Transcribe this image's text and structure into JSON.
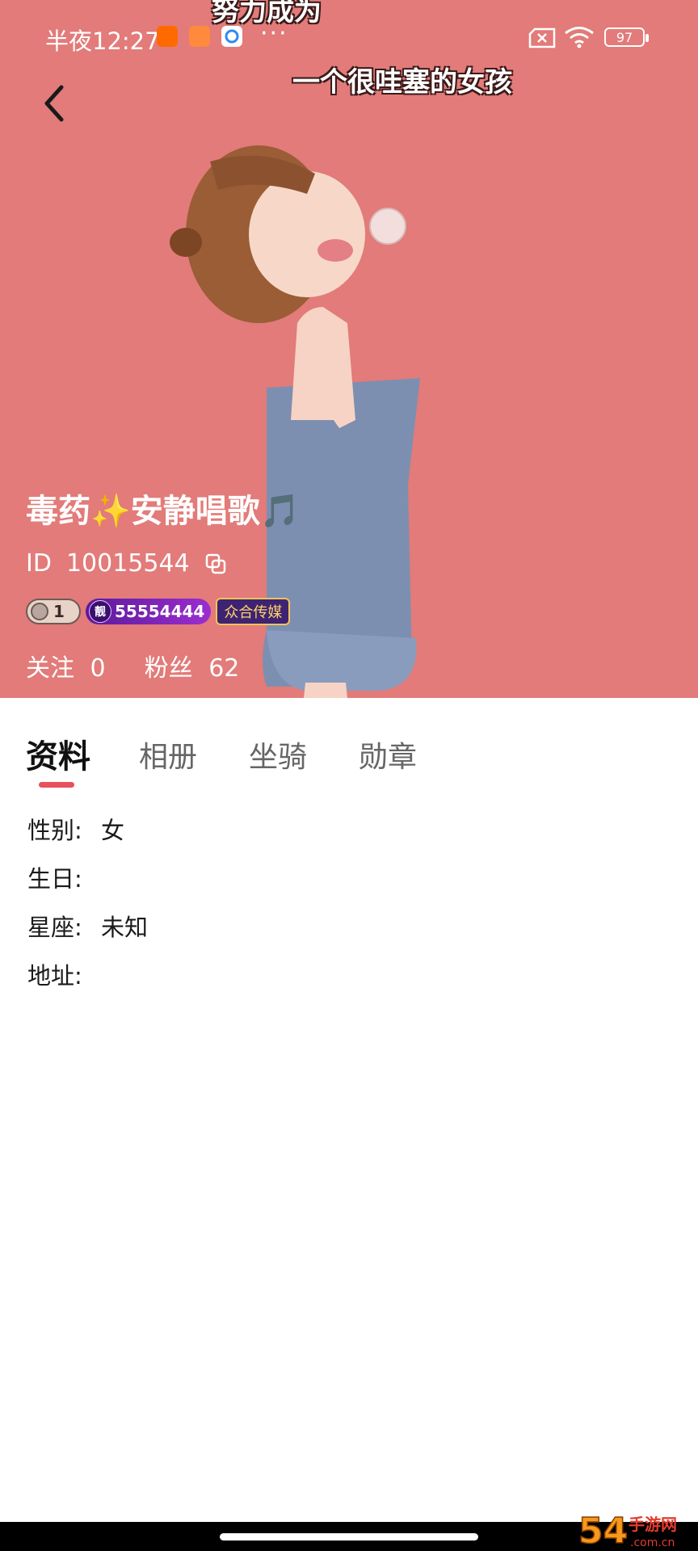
{
  "status_bar": {
    "time": "半夜12:27",
    "battery": "97",
    "icons": [
      "mi-app-icon",
      "shopping-app-icon",
      "browser-app-icon",
      "more-dots-icon",
      "sim-x-icon",
      "wifi-icon",
      "battery-icon"
    ]
  },
  "hero": {
    "caption_top": "努力成为",
    "caption_bottom": "一个很哇塞的女孩",
    "background_color": "#e27b79"
  },
  "profile": {
    "name": "毒药✨安静唱歌🎵",
    "id_label": "ID",
    "id_value": "10015544",
    "level": "1",
    "pretty_number": "55554444",
    "pretty_tag": "靓",
    "guild": "众合传媒",
    "following_label": "关注",
    "following_count": "0",
    "fans_label": "粉丝",
    "fans_count": "62"
  },
  "tabs": [
    {
      "label": "资料",
      "active": true
    },
    {
      "label": "相册",
      "active": false
    },
    {
      "label": "坐骑",
      "active": false
    },
    {
      "label": "勋章",
      "active": false
    }
  ],
  "info": {
    "gender_label": "性别:",
    "gender_value": "女",
    "birthday_label": "生日:",
    "birthday_value": "",
    "zodiac_label": "星座:",
    "zodiac_value": "未知",
    "address_label": "地址:",
    "address_value": ""
  },
  "watermark": "54手游网"
}
